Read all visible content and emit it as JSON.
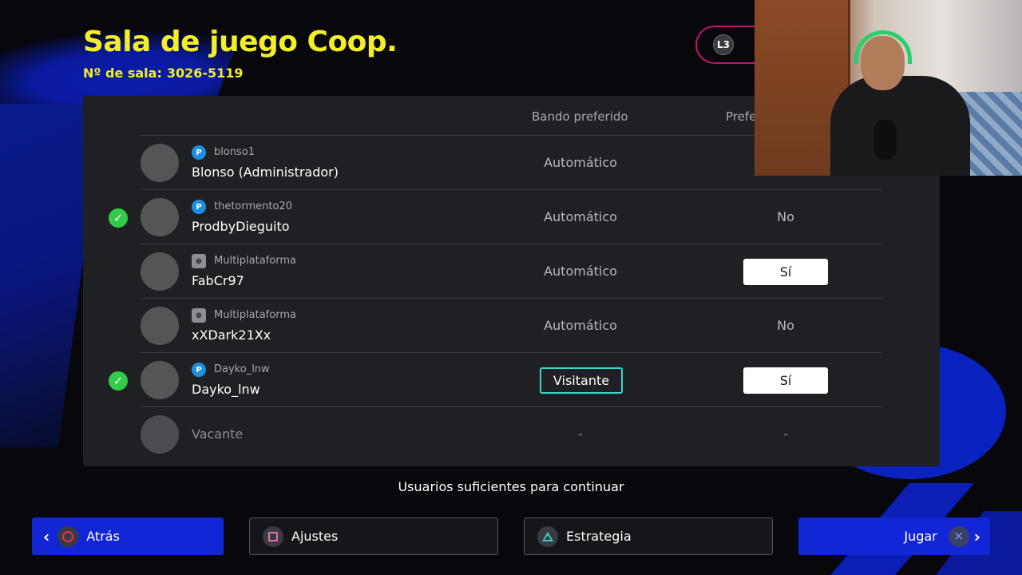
{
  "header": {
    "title": "Sala de juego Coop.",
    "room_label": "Nº de sala:",
    "room_number": "3026-5119",
    "l3_label": "L3"
  },
  "columns": {
    "side": "Bando preferido",
    "preference": "Prefe"
  },
  "players": [
    {
      "account": "blonso1",
      "platform": "playstation",
      "name": "Blonso (Administrador)",
      "side": "Automático",
      "preference": "",
      "ready": false
    },
    {
      "account": "thetormento20",
      "platform": "playstation",
      "name": "ProdbyDieguito",
      "side": "Automático",
      "preference": "No",
      "ready": true
    },
    {
      "account": "Multiplataforma",
      "platform": "crossplay",
      "name": "FabCr97",
      "side": "Automático",
      "preference": "Sí",
      "ready": false
    },
    {
      "account": "Multiplataforma",
      "platform": "crossplay",
      "name": "xXDark21Xx",
      "side": "Automático",
      "preference": "No",
      "ready": false
    },
    {
      "account": "Dayko_lnw",
      "platform": "playstation",
      "name": "Dayko_lnw",
      "side": "Visitante",
      "preference": "Sí",
      "ready": true
    }
  ],
  "vacant": {
    "label": "Vacante",
    "side": "-",
    "preference": "-"
  },
  "status_message": "Usuarios suficientes para continuar",
  "buttons": {
    "back": "Atrás",
    "settings": "Ajustes",
    "strategy": "Estrategia",
    "play": "Jugar"
  },
  "colors": {
    "title": "#f2ee2a",
    "accent_blue": "#1226d6",
    "ready_green": "#33cc4a",
    "highlight_cyan": "#39d7cf"
  }
}
